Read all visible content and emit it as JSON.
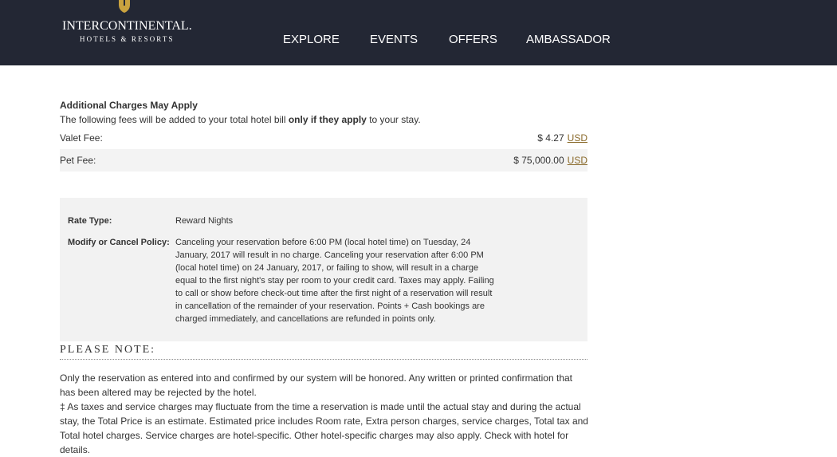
{
  "header": {
    "brand_main": "INTERCONTINENTAL.",
    "brand_sub": "HOTELS & RESORTS",
    "nav": [
      "EXPLORE",
      "EVENTS",
      "OFFERS",
      "AMBASSADOR"
    ]
  },
  "charges": {
    "title": "Additional Charges May Apply",
    "desc_before": "The following fees will be added to your total hotel bill ",
    "desc_bold": "only if they apply",
    "desc_after": " to your stay.",
    "fees": [
      {
        "label": "Valet Fee:",
        "amount": "$ 4.27",
        "currency": "USD"
      },
      {
        "label": "Pet Fee:",
        "amount": "$ 75,000.00",
        "currency": "USD"
      }
    ]
  },
  "policy": {
    "rate_type_label": "Rate Type:",
    "rate_type_value": "Reward Nights",
    "cancel_label": "Modify or Cancel Policy:",
    "cancel_lines": [
      "Canceling your reservation before 6:00 PM (local hotel time) on Tuesday, 24",
      "January, 2017 will result in no charge. Canceling your reservation after 6:00 PM",
      "(local hotel time) on 24 January, 2017, or failing to show, will result in a charge",
      "equal to the first night's stay per room to your credit card. Taxes may apply. Failing",
      "to call or show before check-out time after the first night of a reservation will result",
      "in cancellation of the remainder of your reservation. Points + Cash bookings are",
      "charged immediately, and cancellations are refunded in points only."
    ]
  },
  "note": {
    "heading": "PLEASE NOTE:",
    "para1": "Only the reservation as entered into and confirmed by our system will be honored. Any written or printed confirmation that has been altered may be rejected by the hotel.",
    "para2": "‡ As taxes and service charges may fluctuate from the time a reservation is made until the actual stay and during the actual stay, the Total Price is an estimate. Estimated price includes Room rate, Extra person charges, service charges, Total tax and Total hotel charges. Service charges are hotel-specific. Other hotel-specific charges may also apply. Check with hotel for details."
  }
}
